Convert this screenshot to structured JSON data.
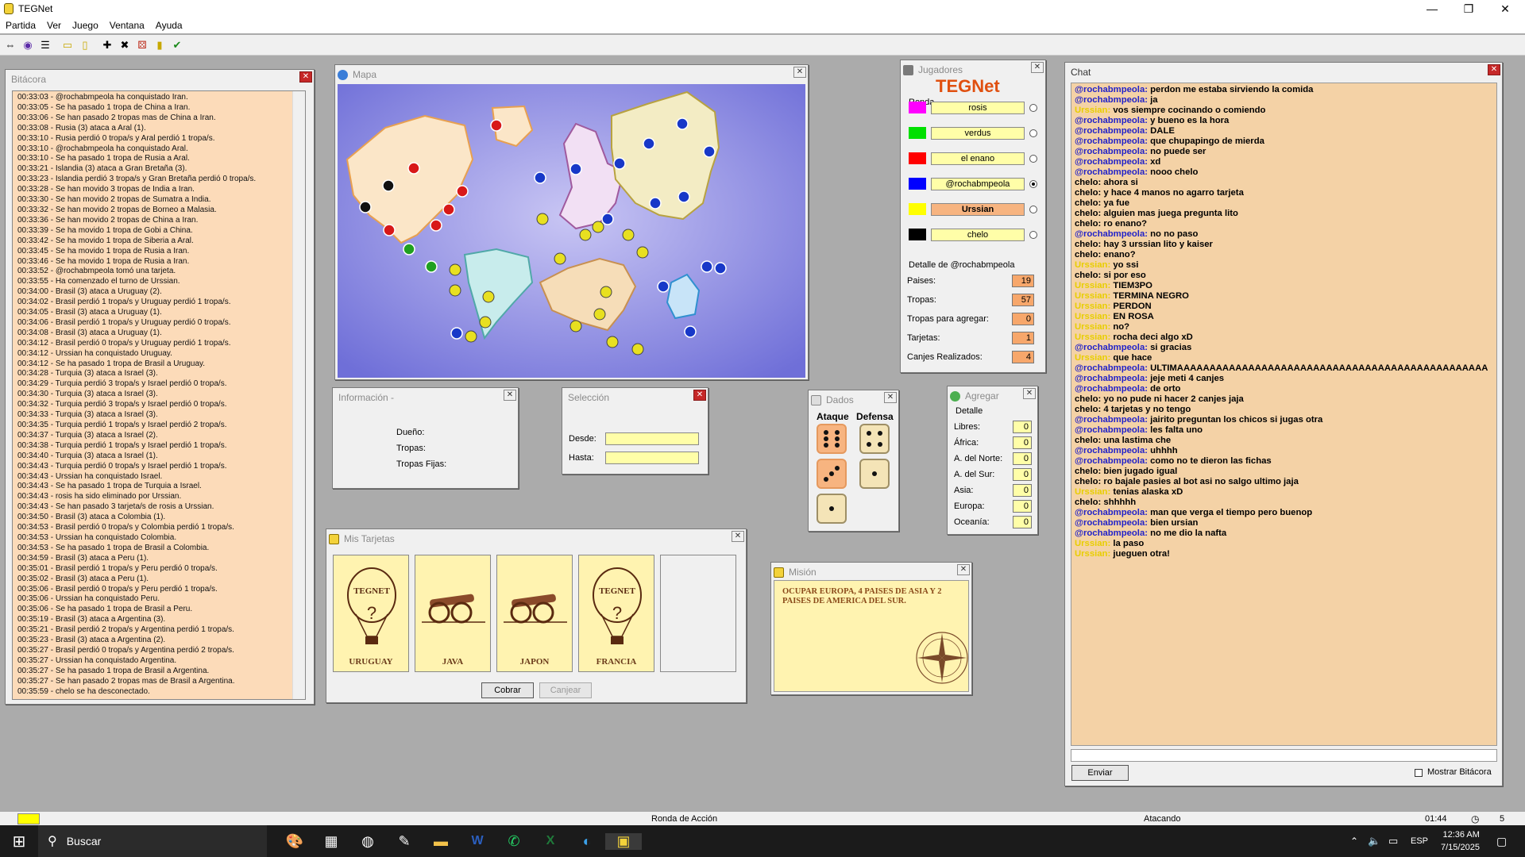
{
  "window": {
    "title": "TEGNet",
    "minimize": "—",
    "maximize": "❐",
    "close": "✕"
  },
  "menu": [
    "Partida",
    "Ver",
    "Juego",
    "Ventana",
    "Ayuda"
  ],
  "toolbar_icons": [
    "connect-icon",
    "globe-icon",
    "list-icon",
    "card-icon",
    "card2-icon",
    "add-icon",
    "swords-icon",
    "dice-icon",
    "cards-icon",
    "check-icon"
  ],
  "log": {
    "title": "Bitácora",
    "lines": [
      "00:33:03 - @rochabmpeola ha conquistado Iran.",
      "00:33:05 - Se ha pasado 1 tropa de China a Iran.",
      "00:33:06 - Se han pasado 2 tropas mas de China a Iran.",
      "00:33:08 - Rusia (3) ataca a Aral (1).",
      "00:33:10 - Rusia perdió 0 tropa/s y Aral perdió 1 tropa/s.",
      "00:33:10 - @rochabmpeola ha conquistado Aral.",
      "00:33:10 - Se ha pasado 1 tropa de Rusia a Aral.",
      "00:33:21 - Islandia (3) ataca a Gran Bretaña (3).",
      "00:33:23 - Islandia perdió 3 tropa/s y Gran Bretaña perdió 0 tropa/s.",
      "00:33:28 - Se han movido 3 tropas de India a Iran.",
      "00:33:30 - Se han movido 2 tropas de Sumatra a India.",
      "00:33:32 - Se han movido 2 tropas de Borneo a Malasia.",
      "00:33:36 - Se han movido 2 tropas de China a Iran.",
      "00:33:39 - Se ha movido 1 tropa de Gobi a China.",
      "00:33:42 - Se ha movido 1 tropa de Siberia a Aral.",
      "00:33:45 - Se ha movido 1 tropa de Rusia a Iran.",
      "00:33:46 - Se ha movido 1 tropa de Rusia a Iran.",
      "00:33:52 - @rochabmpeola tomó una tarjeta.",
      "00:33:55 - Ha comenzado el turno de Urssian.",
      "00:34:00 - Brasil (3) ataca a Uruguay (2).",
      "00:34:02 - Brasil perdió 1 tropa/s y Uruguay perdió 1 tropa/s.",
      "00:34:05 - Brasil (3) ataca a Uruguay (1).",
      "00:34:06 - Brasil perdió 1 tropa/s y Uruguay perdió 0 tropa/s.",
      "00:34:08 - Brasil (3) ataca a Uruguay (1).",
      "00:34:12 - Brasil perdió 0 tropa/s y Uruguay perdió 1 tropa/s.",
      "00:34:12 - Urssian ha conquistado Uruguay.",
      "00:34:12 - Se ha pasado 1 tropa de Brasil a Uruguay.",
      "00:34:28 - Turquia (3) ataca a Israel (3).",
      "00:34:29 - Turquia perdió 3 tropa/s y Israel perdió 0 tropa/s.",
      "00:34:30 - Turquia (3) ataca a Israel (3).",
      "00:34:32 - Turquia perdió 3 tropa/s y Israel perdió 0 tropa/s.",
      "00:34:33 - Turquia (3) ataca a Israel (3).",
      "00:34:35 - Turquia perdió 1 tropa/s y Israel perdió 2 tropa/s.",
      "00:34:37 - Turquia (3) ataca a Israel (2).",
      "00:34:38 - Turquia perdió 1 tropa/s y Israel perdió 1 tropa/s.",
      "00:34:40 - Turquia (3) ataca a Israel (1).",
      "00:34:43 - Turquia perdió 0 tropa/s y Israel perdió 1 tropa/s.",
      "00:34:43 - Urssian ha conquistado Israel.",
      "00:34:43 - Se ha pasado 1 tropa de Turquia a Israel.",
      "00:34:43 - rosis ha sido eliminado por Urssian.",
      "00:34:43 - Se han pasado 3 tarjeta/s de rosis a Urssian.",
      "00:34:50 - Brasil (3) ataca a Colombia (1).",
      "00:34:53 - Brasil perdió 0 tropa/s y Colombia perdió 1 tropa/s.",
      "00:34:53 - Urssian ha conquistado Colombia.",
      "00:34:53 - Se ha pasado 1 tropa de Brasil a Colombia.",
      "00:34:59 - Brasil (3) ataca a Peru (1).",
      "00:35:01 - Brasil perdió 1 tropa/s y Peru perdió 0 tropa/s.",
      "00:35:02 - Brasil (3) ataca a Peru (1).",
      "00:35:06 - Brasil perdió 0 tropa/s y Peru perdió 1 tropa/s.",
      "00:35:06 - Urssian ha conquistado Peru.",
      "00:35:06 - Se ha pasado 1 tropa de Brasil a Peru.",
      "00:35:19 - Brasil (3) ataca a Argentina (3).",
      "00:35:21 - Brasil perdió 2 tropa/s y Argentina perdió 1 tropa/s.",
      "00:35:23 - Brasil (3) ataca a Argentina (2).",
      "00:35:27 - Brasil perdió 0 tropa/s y Argentina perdió 2 tropa/s.",
      "00:35:27 - Urssian ha conquistado Argentina.",
      "00:35:27 - Se ha pasado 1 tropa de Brasil a Argentina.",
      "00:35:27 - Se han pasado 2 tropas mas de Brasil a Argentina.",
      "00:35:59 - chelo se ha desconectado."
    ]
  },
  "map": {
    "title": "Mapa"
  },
  "players": {
    "title": "Jugadores",
    "logo": "TEGNet",
    "ronda_label": "Ronda",
    "list": [
      {
        "name": "rosis",
        "color": "#ff00ff"
      },
      {
        "name": "verdus",
        "color": "#00e000"
      },
      {
        "name": "el enano",
        "color": "#ff0000"
      },
      {
        "name": "@rochabmpeola",
        "color": "#0000ff"
      },
      {
        "name": "Urssian",
        "color": "#ffff00"
      },
      {
        "name": "chelo",
        "color": "#000000"
      }
    ],
    "detail_title": "Detalle de @rochabmpeola",
    "detail": [
      {
        "label": "Paises:",
        "value": "19"
      },
      {
        "label": "Tropas:",
        "value": "57"
      },
      {
        "label": "Tropas para agregar:",
        "value": "0"
      },
      {
        "label": "Tarjetas:",
        "value": "1"
      },
      {
        "label": "Canjes Realizados:",
        "value": "4"
      }
    ]
  },
  "chat": {
    "title": "Chat",
    "send": "Enviar",
    "show_log": "Mostrar Bitácora",
    "lines": [
      [
        "@rochabmpeola:",
        "perdon me estaba sirviendo la comida",
        "u"
      ],
      [
        "@rochabmpeola:",
        "ja",
        "u"
      ],
      [
        "Urssian:",
        "vos siempre cocinando o comiendo",
        "u2"
      ],
      [
        "@rochabmpeola:",
        "y bueno es la hora",
        "u"
      ],
      [
        "@rochabmpeola:",
        "DALE",
        "u"
      ],
      [
        "@rochabmpeola:",
        " que chupapingo de mierda",
        "u"
      ],
      [
        "@rochabmpeola:",
        "no puede ser",
        "u"
      ],
      [
        "@rochabmpeola:",
        "xd",
        "u"
      ],
      [
        "@rochabmpeola:",
        "nooo chelo",
        "u"
      ],
      [
        "chelo:",
        "ahora si",
        "u3"
      ],
      [
        "chelo:",
        "y hace 4 manos no agarro tarjeta",
        "u3"
      ],
      [
        "chelo:",
        "ya fue",
        "u3"
      ],
      [
        "chelo:",
        "alguien mas juega pregunta lito",
        "u3"
      ],
      [
        "chelo:",
        "ro enano?",
        "u3"
      ],
      [
        "@rochabmpeola:",
        "no no paso",
        "u"
      ],
      [
        "chelo:",
        "hay 3 urssian lito y kaiser",
        "u3"
      ],
      [
        "chelo:",
        "enano?",
        "u3"
      ],
      [
        "Urssian:",
        "yo ssi",
        "u2"
      ],
      [
        "chelo:",
        "si por eso",
        "u3"
      ],
      [
        "Urssian:",
        "TIEM3PO",
        "u2"
      ],
      [
        "Urssian:",
        "TERMINA NEGRO",
        "u2"
      ],
      [
        "Urssian:",
        "PERDON",
        "u2"
      ],
      [
        "Urssian:",
        "EN ROSA",
        "u2"
      ],
      [
        "Urssian:",
        "no?",
        "u2"
      ],
      [
        "Urssian:",
        "rocha deci algo xD",
        "u2"
      ],
      [
        "@rochabmpeola:",
        "si gracias",
        "u"
      ],
      [
        "Urssian:",
        "que hace",
        "u2"
      ],
      [
        "@rochabmpeola:",
        "ULTIMAAAAAAAAAAAAAAAAAAAAAAAAAAAAAAAAAAAAAAAAAAAAAAAA",
        "u"
      ],
      [
        "@rochabmpeola:",
        "jeje meti 4 canjes",
        "u"
      ],
      [
        "@rochabmpeola:",
        "de orto",
        "u"
      ],
      [
        "chelo:",
        "yo no pude ni hacer 2 canjes jaja",
        "u3"
      ],
      [
        "chelo:",
        "4 tarjetas y no tengo",
        "u3"
      ],
      [
        "@rochabmpeola:",
        "jairito preguntan los chicos si jugas otra",
        "u"
      ],
      [
        "@rochabmpeola:",
        "les falta uno",
        "u"
      ],
      [
        "chelo:",
        "una lastima che",
        "u3"
      ],
      [
        "@rochabmpeola:",
        "uhhhh",
        "u"
      ],
      [
        "@rochabmpeola:",
        "como no te dieron las fichas",
        "u"
      ],
      [
        "chelo:",
        "bien jugado igual",
        "u3"
      ],
      [
        "chelo:",
        "ro bajale pasies al bot asi no salgo ultimo jaja",
        "u3"
      ],
      [
        "Urssian:",
        "tenias alaska xD",
        "u2"
      ],
      [
        "chelo:",
        "shhhhh",
        "u3"
      ],
      [
        "@rochabmpeola:",
        "man que verga el tiempo pero buenop",
        "u"
      ],
      [
        "@rochabmpeola:",
        "bien ursian",
        "u"
      ],
      [
        "@rochabmpeola:",
        "no me dio la nafta",
        "u"
      ],
      [
        "Urssian:",
        "la paso",
        "u2"
      ],
      [
        "Urssian:",
        "jueguen otra!",
        "u2"
      ]
    ]
  },
  "info": {
    "title": "Información -",
    "owner": "Dueño:",
    "troops": "Tropas:",
    "fixed": "Tropas Fijas:"
  },
  "selection": {
    "title": "Selección",
    "from": "Desde:",
    "to": "Hasta:"
  },
  "dice": {
    "title": "Dados",
    "attack": "Ataque",
    "defense": "Defensa"
  },
  "add": {
    "title": "Agregar",
    "detail": "Detalle",
    "rows": [
      {
        "label": "Libres:",
        "value": "0"
      },
      {
        "label": "África:",
        "value": "0"
      },
      {
        "label": "A. del Norte:",
        "value": "0"
      },
      {
        "label": "A. del Sur:",
        "value": "0"
      },
      {
        "label": "Asia:",
        "value": "0"
      },
      {
        "label": "Europa:",
        "value": "0"
      },
      {
        "label": "Oceanía:",
        "value": "0"
      }
    ]
  },
  "cards": {
    "title": "Mis Tarjetas",
    "list": [
      "URUGUAY",
      "JAVA",
      "JAPON",
      "FRANCIA"
    ],
    "redeem": "Cobrar",
    "exchange": "Canjear"
  },
  "mission": {
    "title": "Misión",
    "text": "OCUPAR EUROPA, 4 PAISES DE ASIA Y 2 PAISES DE AMERICA DEL SUR."
  },
  "status": {
    "phase": "Ronda de Acción",
    "state": "Atacando",
    "time": "01:44",
    "count": "5"
  },
  "taskbar": {
    "search": "Buscar",
    "lang": "ESP",
    "time": "12:36 AM",
    "date": "7/15/2025"
  }
}
